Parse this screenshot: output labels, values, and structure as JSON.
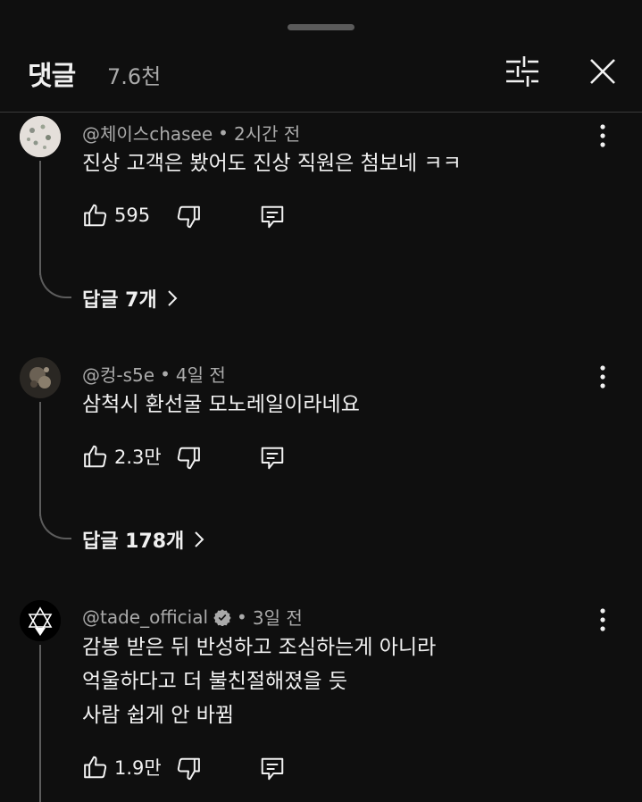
{
  "header": {
    "title": "댓글",
    "count": "7.6천"
  },
  "comments": [
    {
      "author": "@체이스chasee",
      "sep": "•",
      "time": "2시간 전",
      "lines": [
        "진상 고객은 봤어도 진상 직원은 첨보네 ㅋㅋ"
      ],
      "likes": "595",
      "replies": "답글 7개"
    },
    {
      "author": "@컹-s5e",
      "sep": "•",
      "time": "4일 전",
      "lines": [
        "삼척시 환선굴 모노레일이라네요"
      ],
      "likes": "2.3만",
      "replies": "답글 178개"
    },
    {
      "author": "@tade_official",
      "sep": "•",
      "time": "3일 전",
      "lines": [
        "감봉 받은 뒤 반성하고 조심하는게 아니라",
        "억울하다고 더 불친절해졌을 듯",
        "사람 쉽게 안 바뀜"
      ],
      "likes": "1.9만",
      "verified": true
    }
  ],
  "colors": {
    "background": "#0f0f0f",
    "text": "#f1f1f1",
    "muted": "#aaaaaa",
    "thread_line": "#5c5c5c"
  },
  "icons": [
    "filter-icon",
    "close-icon",
    "more-vert-icon",
    "thumb-up-icon",
    "thumb-down-icon",
    "reply-icon",
    "chevron-right-icon",
    "verified-icon"
  ]
}
